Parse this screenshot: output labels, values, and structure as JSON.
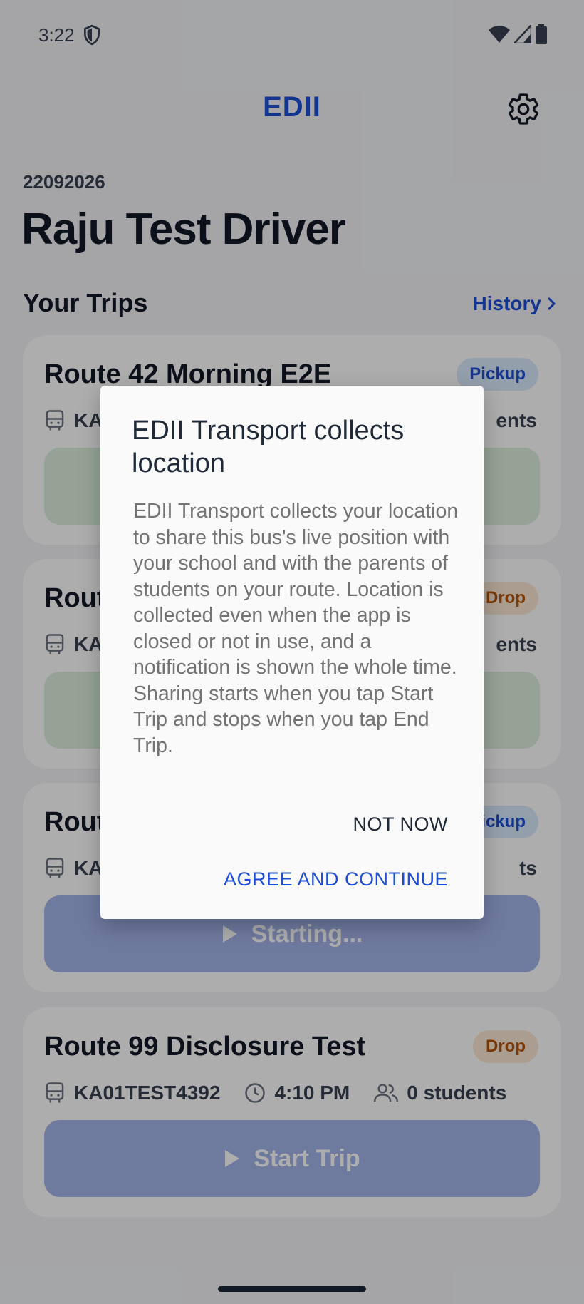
{
  "status_bar": {
    "time": "3:22"
  },
  "header": {
    "title": "EDII"
  },
  "driver": {
    "id": "22092026",
    "name": "Raju Test Driver"
  },
  "trips_section": {
    "title": "Your Trips",
    "history_label": "History"
  },
  "trips": [
    {
      "name": "Route 42 Morning E2E",
      "badge": "Pickup",
      "vehicle": "KA",
      "count_suffix": "ents",
      "button_label": ""
    },
    {
      "name": "Rout",
      "badge": "Drop",
      "vehicle": "KA",
      "count_suffix": "ents",
      "button_label": ""
    },
    {
      "name": "Rout",
      "badge": "ickup",
      "vehicle": "KA",
      "count_suffix": "ts",
      "button_label": "Starting..."
    },
    {
      "name": "Route 99 Disclosure Test",
      "badge": "Drop",
      "vehicle": "KA01TEST4392",
      "time": "4:10 PM",
      "students": "0 students",
      "button_label": "Start Trip"
    }
  ],
  "dialog": {
    "title": "EDII Transport collects location",
    "body": "EDII Transport collects your location to share this bus's live position with your school and with the parents of students on your route. Location is collected even when the app is closed or not in use, and a notification is shown the whole time. Sharing starts when you tap Start Trip and stops when you tap End Trip.",
    "not_now": "NOT NOW",
    "agree": "AGREE AND CONTINUE"
  },
  "colors": {
    "accent": "#1d4ed8",
    "pickup_badge_bg": "#dbeafe",
    "drop_badge_bg": "#fde9d4",
    "drop_text": "#b45309"
  }
}
